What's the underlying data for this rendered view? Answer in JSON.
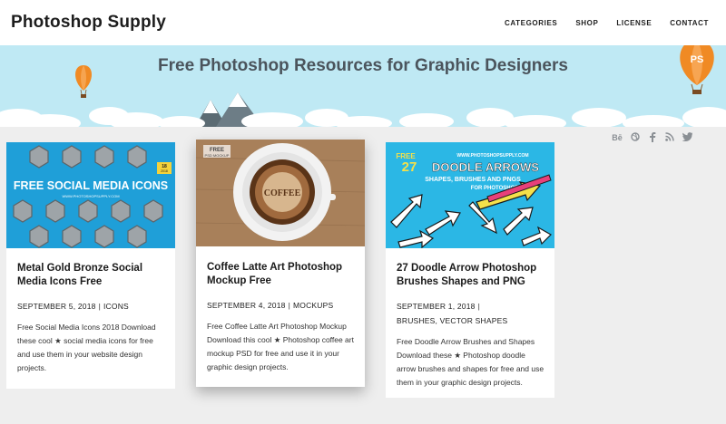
{
  "site": {
    "logo": "Photoshop Supply"
  },
  "nav": {
    "items": [
      "CATEGORIES",
      "SHOP",
      "LICENSE",
      "CONTACT"
    ]
  },
  "banner": {
    "title": "Free Photoshop Resources for Graphic Designers",
    "balloon_text": "PS"
  },
  "social": {
    "icons": [
      "behance-icon",
      "dribbble-icon",
      "facebook-icon",
      "rss-icon",
      "twitter-icon"
    ],
    "behance_text": "Bē"
  },
  "posts": [
    {
      "thumb_text": [
        "FREE SOCIAL MEDIA ICONS",
        "WWW.PHOTOSHOPSUPPLY.COM",
        "18",
        "2018"
      ],
      "title": "Metal Gold Bronze Social Media Icons Free",
      "date": "SEPTEMBER 5, 2018",
      "category": "ICONS",
      "excerpt": "Free Social Media Icons 2018 Download these cool ★ social media icons for free and use them in your website design projects."
    },
    {
      "thumb_text": [
        "FREE",
        "PSD MOCKUP",
        "COFFEE"
      ],
      "title": "Coffee Latte Art Photoshop Mockup Free",
      "date": "SEPTEMBER 4, 2018",
      "category": "MOCKUPS",
      "excerpt": "Free Coffee Latte Art Photoshop Mockup Download this cool ★ Photoshop coffee art mockup PSD for free and use it in your graphic design projects."
    },
    {
      "thumb_text": [
        "WWW.PHOTOSHOPSUPPLY.COM",
        "FREE",
        "27",
        "DOODLE ARROWS",
        "SHAPES, BRUSHES AND PNGS",
        "FOR PHOTOSHOP"
      ],
      "title": "27 Doodle Arrow Photoshop Brushes Shapes and PNG",
      "date": "SEPTEMBER 1, 2018",
      "category": "BRUSHES, VECTOR SHAPES",
      "excerpt": "Free Doodle Arrow Brushes and Shapes Download these ★ Photoshop doodle arrow brushes and shapes for free and use them in your graphic design projects."
    }
  ],
  "colors": {
    "banner_bg": "#bfe9f4",
    "page_bg": "#eeeeee",
    "balloon": "#f08a24"
  },
  "separator": "|"
}
